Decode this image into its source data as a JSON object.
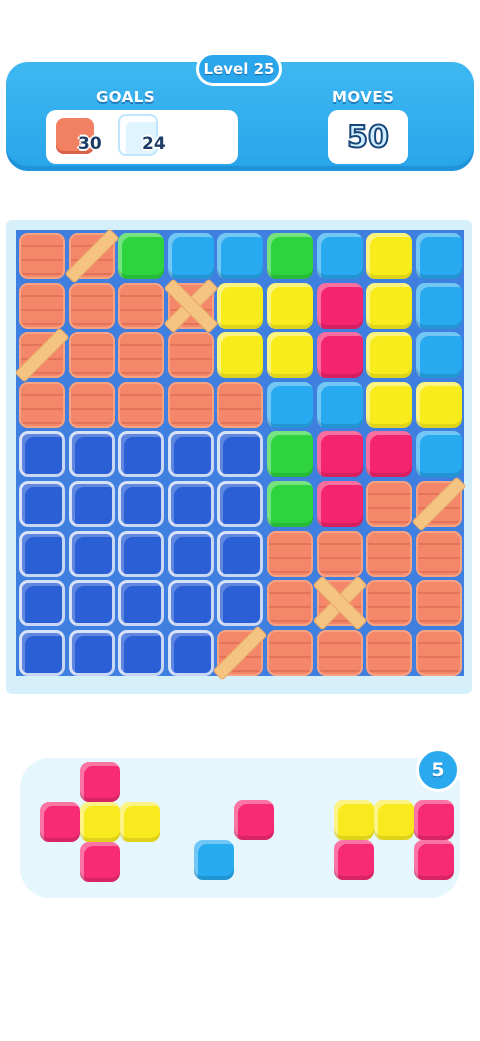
{
  "header": {
    "level_label": "Level 25",
    "goals_label": "GOALS",
    "moves_label": "MOVES",
    "moves_value": "50",
    "goals": [
      {
        "type": "wood-crate",
        "count": "30"
      },
      {
        "type": "ice-block",
        "count": "24"
      }
    ]
  },
  "board": {
    "rows": 9,
    "cols": 9,
    "cells": [
      [
        "wood",
        "wood-plank",
        "green",
        "blue",
        "blue",
        "green",
        "blue",
        "yellow",
        "blue"
      ],
      [
        "wood",
        "wood",
        "wood",
        "wood-cross",
        "yellow",
        "yellow",
        "pink",
        "yellow",
        "blue"
      ],
      [
        "wood-plank",
        "wood",
        "wood",
        "wood",
        "yellow",
        "yellow",
        "pink",
        "yellow",
        "blue"
      ],
      [
        "wood",
        "wood",
        "wood",
        "wood",
        "wood",
        "blue",
        "blue",
        "yellow",
        "yellow"
      ],
      [
        "ice",
        "ice",
        "ice",
        "ice",
        "ice",
        "green",
        "pink",
        "pink",
        "blue"
      ],
      [
        "ice",
        "ice",
        "ice",
        "ice",
        "ice",
        "green",
        "pink",
        "wood",
        "wood-plank"
      ],
      [
        "ice",
        "ice",
        "ice",
        "ice",
        "ice",
        "wood",
        "wood",
        "wood",
        "wood"
      ],
      [
        "ice",
        "ice",
        "ice",
        "ice",
        "ice",
        "wood",
        "wood-cross",
        "wood",
        "wood"
      ],
      [
        "ice",
        "ice",
        "ice",
        "ice",
        "wood-plank",
        "wood",
        "wood",
        "wood",
        "wood"
      ]
    ],
    "colors": {
      "green": "#2dd43e",
      "blue": "#27aaef",
      "yellow": "#f8ec1c",
      "pink": "#f4246e",
      "wood": "#f4866a",
      "ice": "#2a5fd6"
    }
  },
  "tray": {
    "pieces_left": "5",
    "pieces": [
      {
        "name": "plus-piece",
        "blocks": [
          [
            1,
            0,
            "pink"
          ],
          [
            0,
            1,
            "pink"
          ],
          [
            1,
            1,
            "yellow"
          ],
          [
            2,
            1,
            "yellow"
          ],
          [
            1,
            2,
            "pink"
          ]
        ]
      },
      {
        "name": "diagonal-piece",
        "blocks": [
          [
            1,
            0,
            "pink"
          ],
          [
            0,
            1,
            "blue"
          ]
        ]
      },
      {
        "name": "s-piece",
        "blocks": [
          [
            0,
            0,
            "yellow"
          ],
          [
            1,
            0,
            "yellow"
          ],
          [
            2,
            0,
            "pink"
          ],
          [
            0,
            1,
            "pink"
          ],
          [
            2,
            1,
            "pink"
          ]
        ]
      }
    ]
  }
}
